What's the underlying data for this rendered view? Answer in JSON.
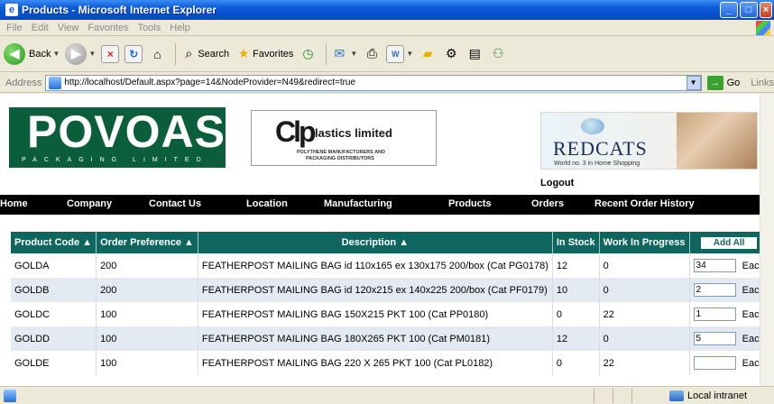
{
  "window": {
    "title": "Products - Microsoft Internet Explorer"
  },
  "menu": [
    "File",
    "Edit",
    "View",
    "Favorites",
    "Tools",
    "Help"
  ],
  "toolbar": {
    "back": "Back",
    "search": "Search",
    "favorites": "Favorites"
  },
  "address": {
    "label": "Address",
    "url": "http://localhost/Default.aspx?page=14&NodeProvider=N49&redirect=true",
    "go": "Go",
    "links": "Links"
  },
  "header": {
    "povoas_big": "POVOAS",
    "povoas_small": "PACKAGING LIMITED",
    "clp_mark": "Clp",
    "clp_name": "lastics limited",
    "clp_sub1": "POLYTHENE MANUFACTURERS AND",
    "clp_sub2": "PACKAGING DISTRIBUTORS",
    "redcats_name": "REDCATS",
    "redcats_tag": "World no. 3 in Home Shopping",
    "logout": "Logout"
  },
  "nav": [
    "Home",
    "Company",
    "Contact Us",
    "Location",
    "Manufacturing",
    "Products",
    "Orders",
    "Recent Order History"
  ],
  "table": {
    "headers": [
      "Product Code ▲",
      "Order Preference ▲",
      "Description ▲",
      "In Stock",
      "Work In Progress"
    ],
    "add_all": "Add All",
    "unit": "Each",
    "rows": [
      {
        "code": "GOLDA",
        "pref": "200",
        "desc": "FEATHERPOST MAILING BAG id 110x165 ex 130x175 200/box (Cat PG0178)",
        "stock": "12",
        "wip": "0",
        "qty": "34"
      },
      {
        "code": "GOLDB",
        "pref": "200",
        "desc": "FEATHERPOST MAILING BAG id 120x215 ex 140x225 200/box (Cat PF0179)",
        "stock": "10",
        "wip": "0",
        "qty": "2"
      },
      {
        "code": "GOLDC",
        "pref": "100",
        "desc": "FEATHERPOST MAILING BAG 150X215 PKT 100 (Cat PP0180)",
        "stock": "0",
        "wip": "22",
        "qty": "1"
      },
      {
        "code": "GOLDD",
        "pref": "100",
        "desc": "FEATHERPOST MAILING BAG 180X265 PKT 100 (Cat PM0181)",
        "stock": "12",
        "wip": "0",
        "qty": "5"
      },
      {
        "code": "GOLDE",
        "pref": "100",
        "desc": "FEATHERPOST MAILING BAG 220 X 265 PKT 100 (Cat PL0182)",
        "stock": "0",
        "wip": "22",
        "qty": ""
      }
    ]
  },
  "status": {
    "zone": "Local intranet"
  }
}
